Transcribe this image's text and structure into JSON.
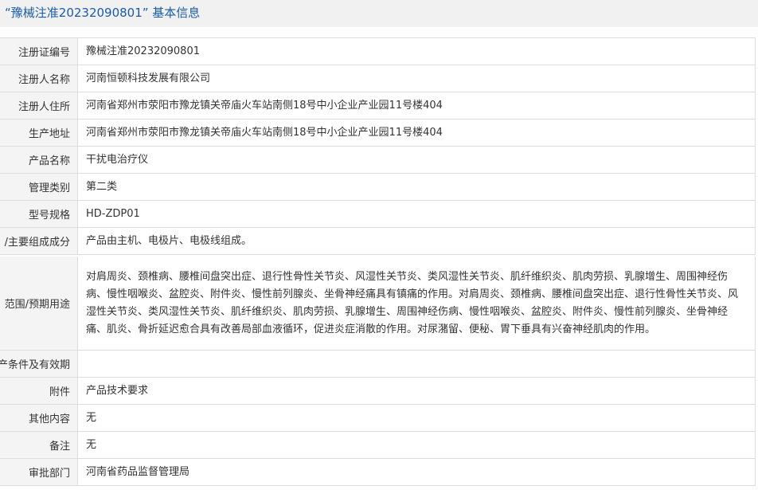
{
  "header": {
    "title_reg": "“豫械注准20232090801”",
    "title_suffix": " 基本信息"
  },
  "rows": [
    {
      "label": "注册证编号",
      "value": "豫械注准20232090801"
    },
    {
      "label": "注册人名称",
      "value": "河南恒顿科技发展有限公司"
    },
    {
      "label": "注册人住所",
      "value": "河南省郑州市荥阳市豫龙镇关帝庙火车站南侧18号中小企业产业园11号楼404"
    },
    {
      "label": "生产地址",
      "value": "河南省郑州市荥阳市豫龙镇关帝庙火车站南侧18号中小企业产业园11号楼404"
    },
    {
      "label": "产品名称",
      "value": "干扰电治疗仪"
    },
    {
      "label": "管理类别",
      "value": "第二类"
    },
    {
      "label": "型号规格",
      "value": "HD-ZDP01"
    },
    {
      "label": "/主要组成成分",
      "value": "产品由主机、电极片、电极线组成。"
    },
    {
      "label": "范围/预期用途",
      "value": "对肩周炎、颈椎病、腰椎间盘突出症、退行性骨性关节炎、风湿性关节炎、类风湿性关节炎、肌纤维织炎、肌肉劳损、乳腺增生、周围神经伤病、慢性咽喉炎、盆腔炎、附件炎、慢性前列腺炎、坐骨神经痛具有镇痛的作用。对肩周炎、颈椎病、腰椎间盘突出症、退行性骨性关节炎、风湿性关节炎、类风湿性关节炎、肌纤维织炎、肌肉劳损、乳腺增生、周围神经伤病、慢性咽喉炎、盆腔炎、附件炎、慢性前列腺炎、坐骨神经痛、肌炎、骨折延迟愈合具有改善局部血液循环，促进炎症消散的作用。对尿潴留、便秘、胃下垂具有兴奋神经肌肉的作用。"
    },
    {
      "label": "产条件及有效期",
      "value": ""
    },
    {
      "label": "附件",
      "value": "产品技术要求"
    },
    {
      "label": "其他内容",
      "value": "无"
    },
    {
      "label": "备注",
      "value": "无"
    },
    {
      "label": "审批部门",
      "value": "河南省药品监督管理局"
    }
  ],
  "colors": {
    "title_text": "#1a5ca8",
    "label_bg": "#f4f4f4",
    "border": "#dcdcdc"
  }
}
